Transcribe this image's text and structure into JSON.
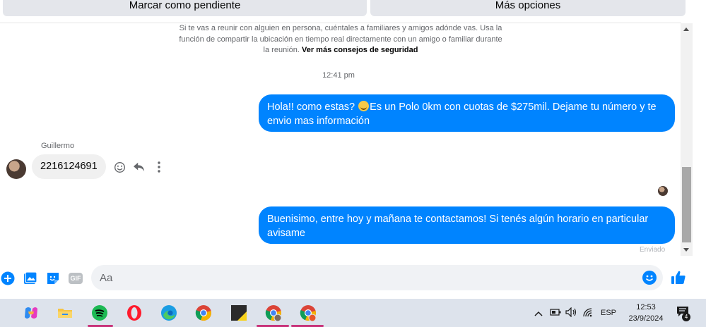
{
  "top_actions": {
    "mark_pending_label": "Marcar como pendiente",
    "more_options_label": "Más opciones"
  },
  "safety_notice": {
    "text": "Si te vas a reunir con alguien en persona, cuéntales a familiares y amigos adónde vas. Usa la función de compartir la ubicación en tiempo real directamente con un amigo o familiar durante la reunión.",
    "link_label": "Ver más consejos de seguridad"
  },
  "conversation": {
    "timestamp": "12:41 pm",
    "messages": [
      {
        "direction": "outgoing",
        "text_before_emoji": "Hola!! como estas?",
        "emoji_icon": "smiling-face-emoji",
        "text_after_emoji": "Es un Polo 0km con cuotas de $275mil. Dejame tu número y te envio mas información"
      },
      {
        "direction": "incoming",
        "sender": "Guillermo",
        "text": "2216124691"
      },
      {
        "direction": "outgoing",
        "text": "Buenisimo, entre hoy y mañana te contactamos! Si tenés algún horario en particular avisame",
        "status": "Enviado"
      }
    ]
  },
  "composer": {
    "placeholder": "Aa",
    "gif_label": "GIF",
    "icons": [
      "plus-icon",
      "photo-icon",
      "sticker-icon",
      "gif-icon",
      "emoji-icon",
      "like-icon"
    ]
  },
  "taskbar": {
    "apps": [
      "copilot-icon",
      "file-explorer-icon",
      "spotify-icon",
      "opera-icon",
      "edge-icon",
      "chrome-icon",
      "sticky-app-icon",
      "chrome-profile-icon",
      "chrome-profile-2-icon"
    ],
    "language": "ESP",
    "time": "12:53",
    "date": "23/9/2024",
    "notification_count": "4"
  },
  "colors": {
    "accent": "#0084ff",
    "bubble_incoming": "#f0f0f0",
    "taskbar": "#dde3ec"
  }
}
